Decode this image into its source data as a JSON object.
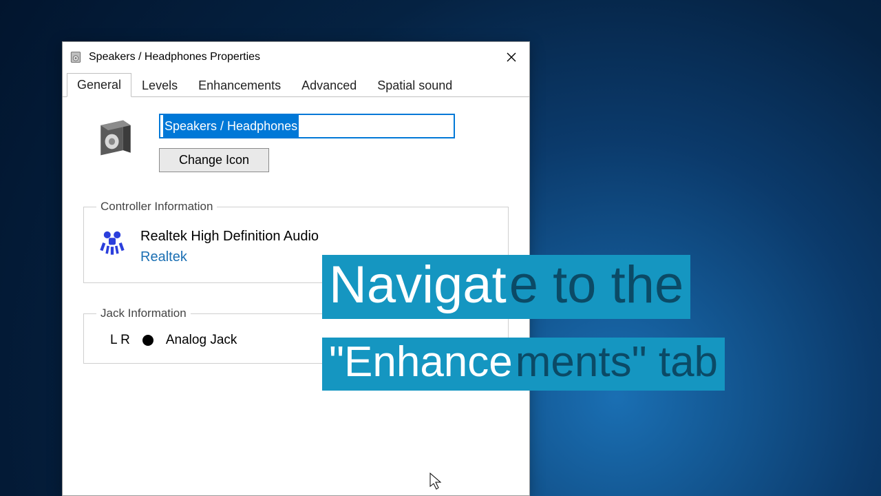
{
  "window": {
    "title": "Speakers / Headphones Properties"
  },
  "tabs": [
    "General",
    "Levels",
    "Enhancements",
    "Advanced",
    "Spatial sound"
  ],
  "active_tab": "General",
  "device": {
    "name": "Speakers / Headphones",
    "change_icon_btn": "Change Icon"
  },
  "controller": {
    "legend": "Controller Information",
    "name": "Realtek High Definition Audio",
    "vendor": "Realtek"
  },
  "jack": {
    "legend": "Jack Information",
    "channels": "L R",
    "type": "Analog Jack"
  },
  "overlay": {
    "line1a": "Navigat",
    "line1b": "e to the",
    "line2a": "\"Enhance",
    "line2b": "ments\" tab"
  }
}
